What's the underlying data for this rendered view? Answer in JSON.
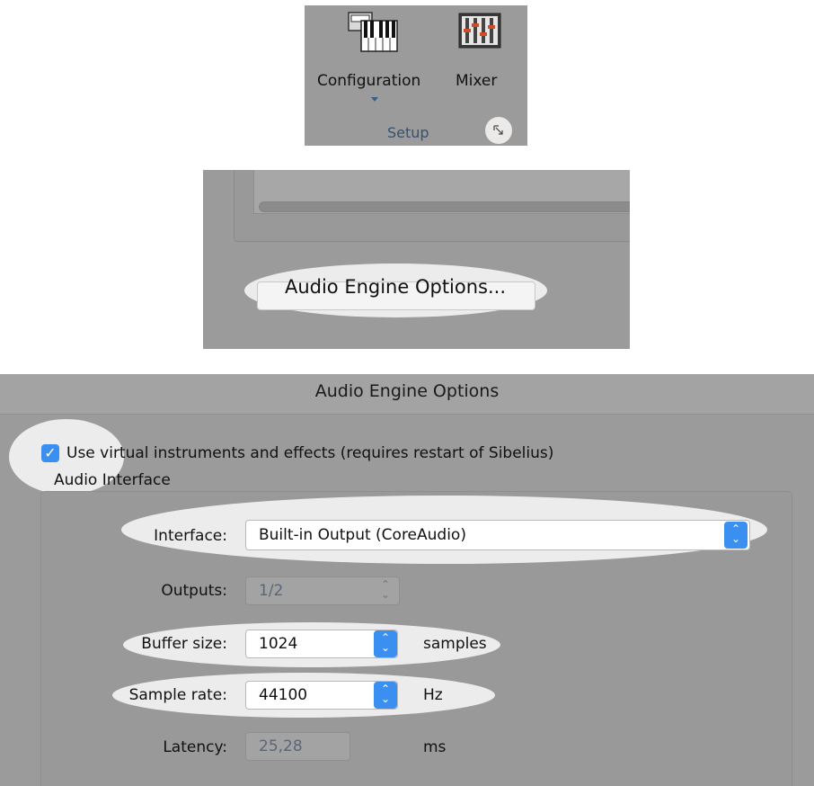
{
  "ribbon": {
    "configuration_label": "Configuration",
    "mixer_label": "Mixer",
    "group_label": "Setup",
    "configuration_icon": "keyboard-icon",
    "mixer_icon": "mixer-icon",
    "launcher_icon": "dialog-launcher-icon"
  },
  "panel2": {
    "button_label": "Audio Engine Options..."
  },
  "dialog": {
    "title": "Audio Engine Options",
    "checkbox_label": "Use virtual instruments and effects (requires restart of Sibelius)",
    "checkbox_checked": true,
    "section_label": "Audio Interface",
    "interface_label": "Interface:",
    "interface_value": "Built-in Output (CoreAudio)",
    "outputs_label": "Outputs:",
    "outputs_value": "1/2",
    "buffer_label": "Buffer size:",
    "buffer_value": "1024",
    "buffer_unit": "samples",
    "rate_label": "Sample rate:",
    "rate_value": "44100",
    "rate_unit": "Hz",
    "latency_label": "Latency:",
    "latency_value": "25,28",
    "latency_unit": "ms"
  },
  "colors": {
    "accent": "#3b8ff0",
    "panel_bg": "#9b9b9b",
    "highlight": "#ececec"
  }
}
